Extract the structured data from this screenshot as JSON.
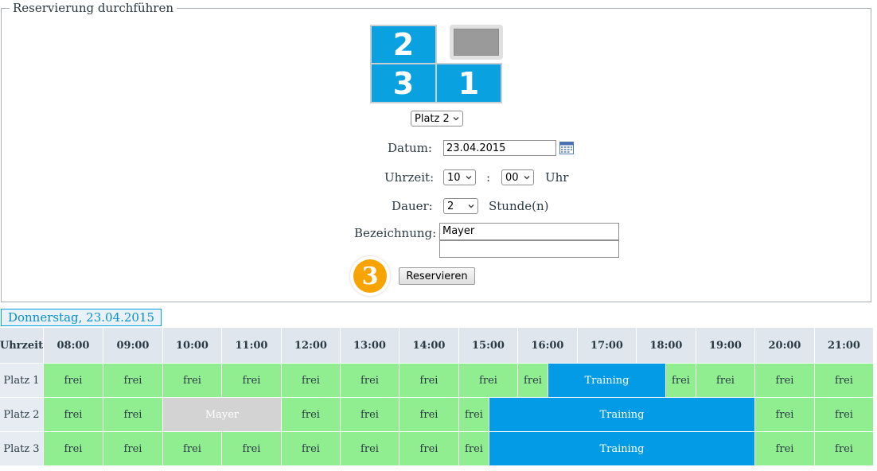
{
  "legend": "Reservierung durchführen",
  "courts": {
    "c2": "2",
    "c3": "3",
    "c1": "1"
  },
  "court_select": "Platz 2",
  "labels": {
    "datum": "Datum:",
    "uhrzeit": "Uhrzeit:",
    "colon": ":",
    "uhr": "Uhr",
    "dauer": "Dauer:",
    "stunden": "Stunde(n)",
    "bezeichnung": "Bezeichnung:"
  },
  "form": {
    "date": "23.04.2015",
    "hour": "10",
    "minute": "00",
    "duration": "2",
    "name1": "Mayer",
    "name2": ""
  },
  "step_number": "3",
  "reserve_button": "Reservieren",
  "schedule": {
    "day": "Donnerstag, 23.04.2015",
    "first_header": "Uhrzeit",
    "hours": [
      "08:00",
      "09:00",
      "10:00",
      "11:00",
      "12:00",
      "13:00",
      "14:00",
      "15:00",
      "16:00",
      "17:00",
      "18:00",
      "19:00",
      "20:00",
      "21:00"
    ],
    "rows": [
      {
        "label": "Platz 1",
        "cells": [
          "frei",
          "frei",
          "frei",
          "frei",
          "frei",
          "frei",
          "frei",
          "frei",
          "frei",
          "Training",
          "frei",
          "frei",
          "frei",
          "frei"
        ]
      },
      {
        "label": "Platz 2",
        "cells": [
          "frei",
          "frei",
          "Mayer",
          "frei",
          "frei",
          "frei",
          "frei",
          "Training",
          "frei",
          "frei"
        ]
      },
      {
        "label": "Platz 3",
        "cells": [
          "frei",
          "frei",
          "frei",
          "frei",
          "frei",
          "frei",
          "frei",
          "frei",
          "Training",
          "frei",
          "frei"
        ]
      }
    ]
  },
  "colors": {
    "free": "#90ee90",
    "training": "#039be5",
    "booked": "#d3d3d3",
    "court": "#0aa1e0",
    "step": "#f7a400"
  }
}
